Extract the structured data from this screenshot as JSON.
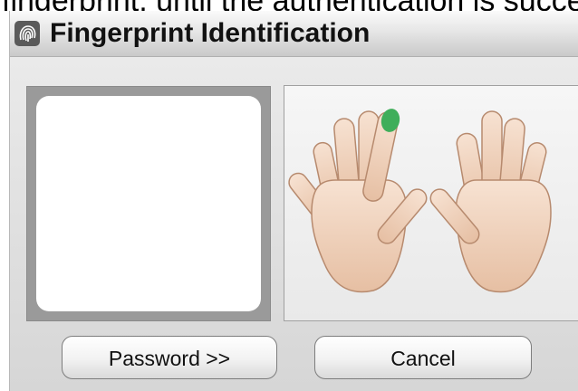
{
  "caption": {
    "text": "fingerprint, until the authentication is successful"
  },
  "dialog": {
    "title": "Fingerprint Identification",
    "icon": "fingerprint-icon"
  },
  "fingerprint_preview": {
    "icon": "fingerprint-scan-area"
  },
  "hands": {
    "highlighted_finger": "left-hand-index-finger",
    "highlight_color": "#3fae5a",
    "skin_color": "#f0d3bd"
  },
  "buttons": {
    "password_label": "Password >>",
    "cancel_label": "Cancel"
  }
}
